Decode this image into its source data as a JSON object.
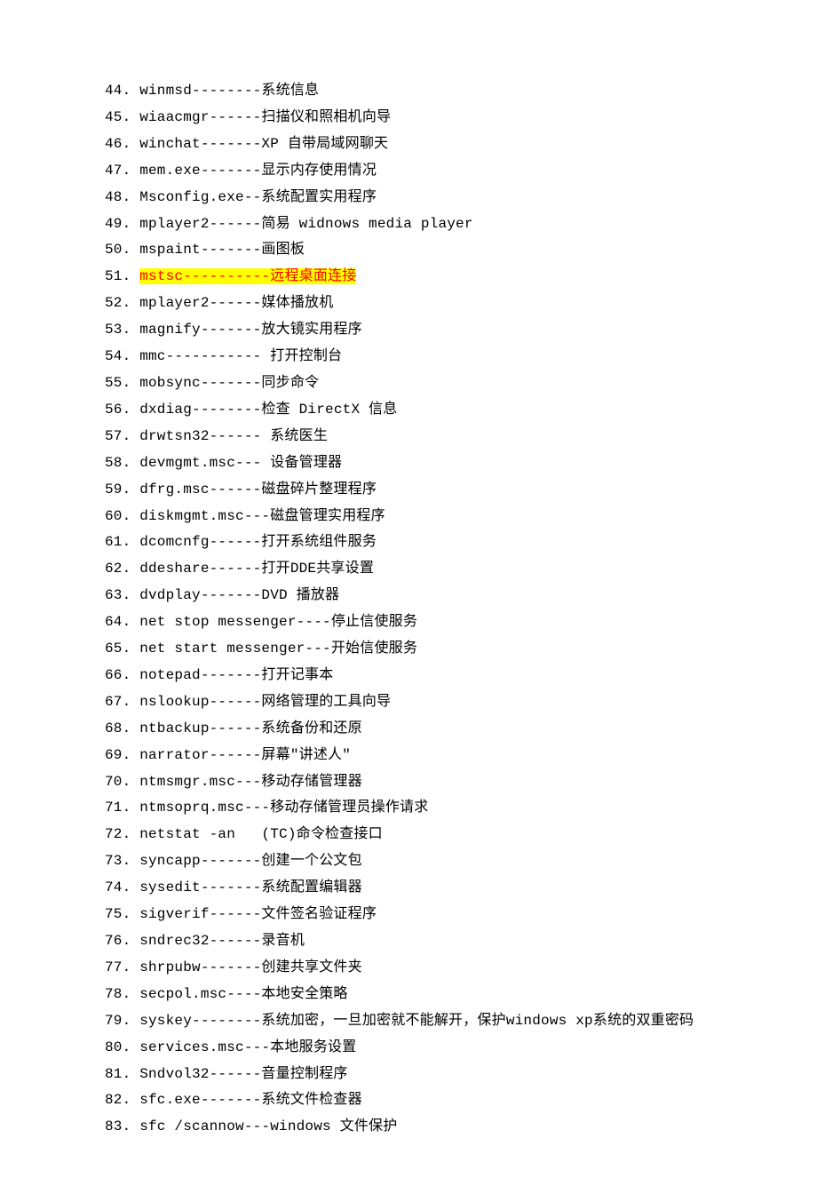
{
  "rows": [
    {
      "text": "44. winmsd--------系统信息"
    },
    {
      "text": "45. wiaacmgr------扫描仪和照相机向导"
    },
    {
      "text": "46. winchat-------XP 自带局域网聊天"
    },
    {
      "text": "47. mem.exe-------显示内存使用情况"
    },
    {
      "text": "48. Msconfig.exe--系统配置实用程序"
    },
    {
      "text": "49. mplayer2------简易 widnows media player"
    },
    {
      "text": "50. mspaint-------画图板"
    },
    {
      "hl_num": "51. ",
      "hl_body": "mstsc----------远程桌面连接"
    },
    {
      "text": "52. mplayer2------媒体播放机"
    },
    {
      "text": "53. magnify-------放大镜实用程序"
    },
    {
      "text": "54. mmc----------- 打开控制台"
    },
    {
      "text": "55. mobsync-------同步命令"
    },
    {
      "text": "56. dxdiag--------检查 DirectX 信息"
    },
    {
      "text": "57. drwtsn32------ 系统医生"
    },
    {
      "text": "58. devmgmt.msc--- 设备管理器"
    },
    {
      "text": "59. dfrg.msc------磁盘碎片整理程序"
    },
    {
      "text": "60. diskmgmt.msc---磁盘管理实用程序"
    },
    {
      "text": "61. dcomcnfg------打开系统组件服务"
    },
    {
      "text": "62. ddeshare------打开DDE共享设置"
    },
    {
      "text": "63. dvdplay-------DVD 播放器"
    },
    {
      "text": "64. net stop messenger----停止信使服务"
    },
    {
      "text": "65. net start messenger---开始信使服务"
    },
    {
      "text": "66. notepad-------打开记事本"
    },
    {
      "text": "67. nslookup------网络管理的工具向导"
    },
    {
      "text": "68. ntbackup------系统备份和还原"
    },
    {
      "text": "69. narrator------屏幕\"讲述人\""
    },
    {
      "text": "70. ntmsmgr.msc---移动存储管理器"
    },
    {
      "text": "71. ntmsoprq.msc---移动存储管理员操作请求"
    },
    {
      "text": "72. netstat -an   (TC)命令检查接口"
    },
    {
      "text": "73. syncapp-------创建一个公文包"
    },
    {
      "text": "74. sysedit-------系统配置编辑器"
    },
    {
      "text": "75. sigverif------文件签名验证程序"
    },
    {
      "text": "76. sndrec32------录音机"
    },
    {
      "text": "77. shrpubw-------创建共享文件夹"
    },
    {
      "text": "78. secpol.msc----本地安全策略"
    },
    {
      "text": "79. syskey--------系统加密，一旦加密就不能解开，保护windows xp系统的双重密码"
    },
    {
      "text": "80. services.msc---本地服务设置"
    },
    {
      "text": "81. Sndvol32------音量控制程序"
    },
    {
      "text": "82. sfc.exe-------系统文件检查器"
    },
    {
      "text": "83. sfc /scannow---windows 文件保护"
    }
  ]
}
